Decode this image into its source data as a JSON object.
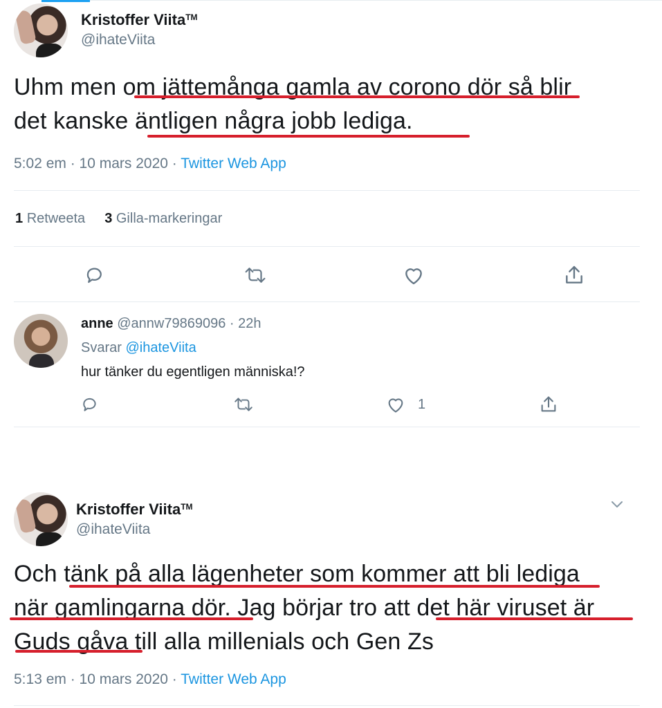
{
  "tweet1": {
    "author_name": "Kristoffer Viita",
    "author_tm": "TM",
    "author_handle": "@ihateViita",
    "text_line1": "Uhm men om jättemånga gamla av corono dör så blir",
    "text_line2": "det kanske äntligen några jobb lediga.",
    "time": "5:02 em · 10 mars 2020 · ",
    "source": "Twitter Web App",
    "retweet_count": "1",
    "retweet_label": "Retweeta",
    "like_count": "3",
    "like_label": "Gilla-markeringar"
  },
  "reply": {
    "author_name": "anne",
    "author_handle": "@annw79869096 · 22h",
    "replying_prefix": "Svarar ",
    "replying_mention": "@ihateViita",
    "text": "hur tänker du egentligen människa!?",
    "like_count": "1"
  },
  "tweet2": {
    "author_name": "Kristoffer Viita",
    "author_tm": "TM",
    "author_handle": "@ihateViita",
    "text_line1": "Och tänk på alla lägenheter som kommer att bli lediga",
    "text_line2": "när gamlingarna dör. Jag börjar tro att det här viruset är",
    "text_line3": "Guds gåva till alla millenials och Gen Zs",
    "time": "5:13 em · 10 mars 2020 · ",
    "source": "Twitter Web App"
  },
  "colors": {
    "underline": "#d61f2c",
    "link": "#1b95e0",
    "secondary": "#657786",
    "accent_top": "#1da1f2"
  }
}
